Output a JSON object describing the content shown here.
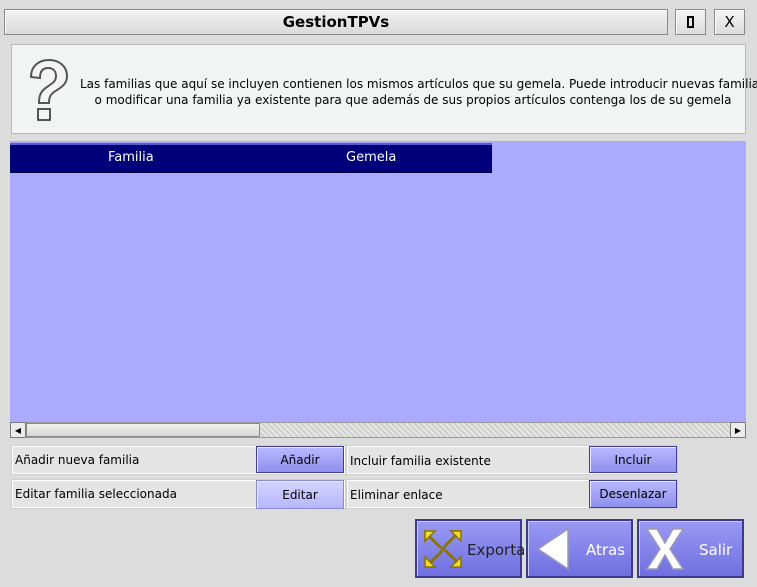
{
  "window": {
    "title": "GestionTPVs",
    "maximize_icon": "maximize-icon",
    "close_label": "X"
  },
  "info": {
    "icon": "question-icon",
    "line1": "Las familias que aquí se incluyen contienen los mismos artículos que su gemela. Puede introducir nuevas familias",
    "line2": "o modificar una familia ya existente para que  además de sus propios artículos contenga los de su gemela"
  },
  "grid": {
    "columns": [
      "Familia",
      "Gemela"
    ],
    "rows": [],
    "header_color": "#00007a",
    "background_color": "#aaaaff"
  },
  "actions": {
    "add_label": "Añadir nueva familia",
    "add_button": "Añadir",
    "include_label": "Incluir familia existente",
    "include_button": "Incluir",
    "edit_label": "Editar familia seleccionada",
    "edit_button": "Editar",
    "delete_label": "Eliminar enlace",
    "delete_button": "Desenlazar"
  },
  "bottom": {
    "export": {
      "label": "Exportar",
      "icon": "export-arrows-icon"
    },
    "back": {
      "label": "Atras",
      "icon": "back-arrow-icon"
    },
    "exit": {
      "label": "Salir",
      "icon": "exit-x-icon"
    }
  }
}
